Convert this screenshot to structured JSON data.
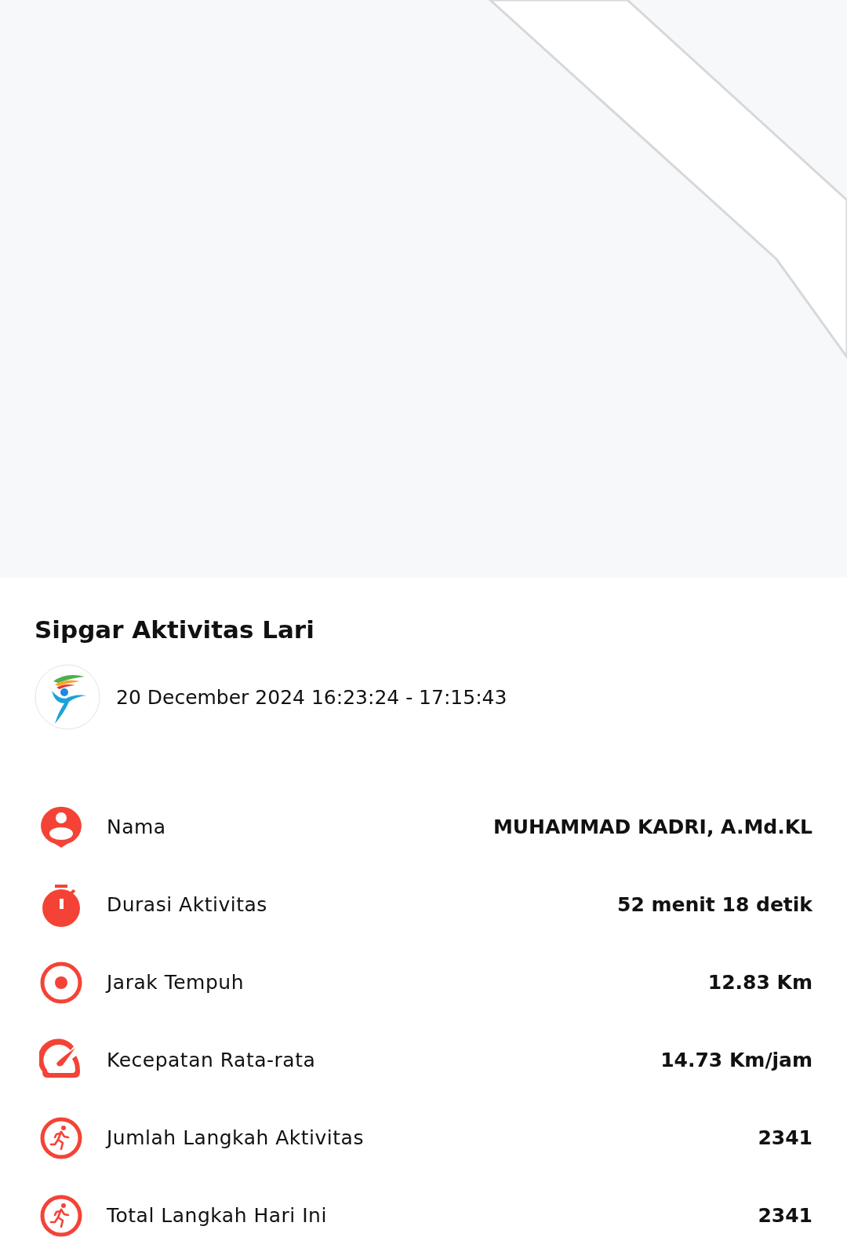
{
  "activity": {
    "title": "Sipgar Aktivitas Lari",
    "datetime": "20 December 2024 16:23:24 - 17:15:43"
  },
  "stats": [
    {
      "label": "Nama",
      "value": "MUHAMMAD KADRI, A.Md.KL"
    },
    {
      "label": "Durasi Aktivitas",
      "value": "52 menit 18 detik"
    },
    {
      "label": "Jarak Tempuh",
      "value": "12.83 Km"
    },
    {
      "label": "Kecepatan Rata-rata",
      "value": "14.73 Km/jam"
    },
    {
      "label": "Jumlah Langkah Aktivitas",
      "value": "2341"
    },
    {
      "label": "Total Langkah Hari Ini",
      "value": "2341"
    }
  ]
}
